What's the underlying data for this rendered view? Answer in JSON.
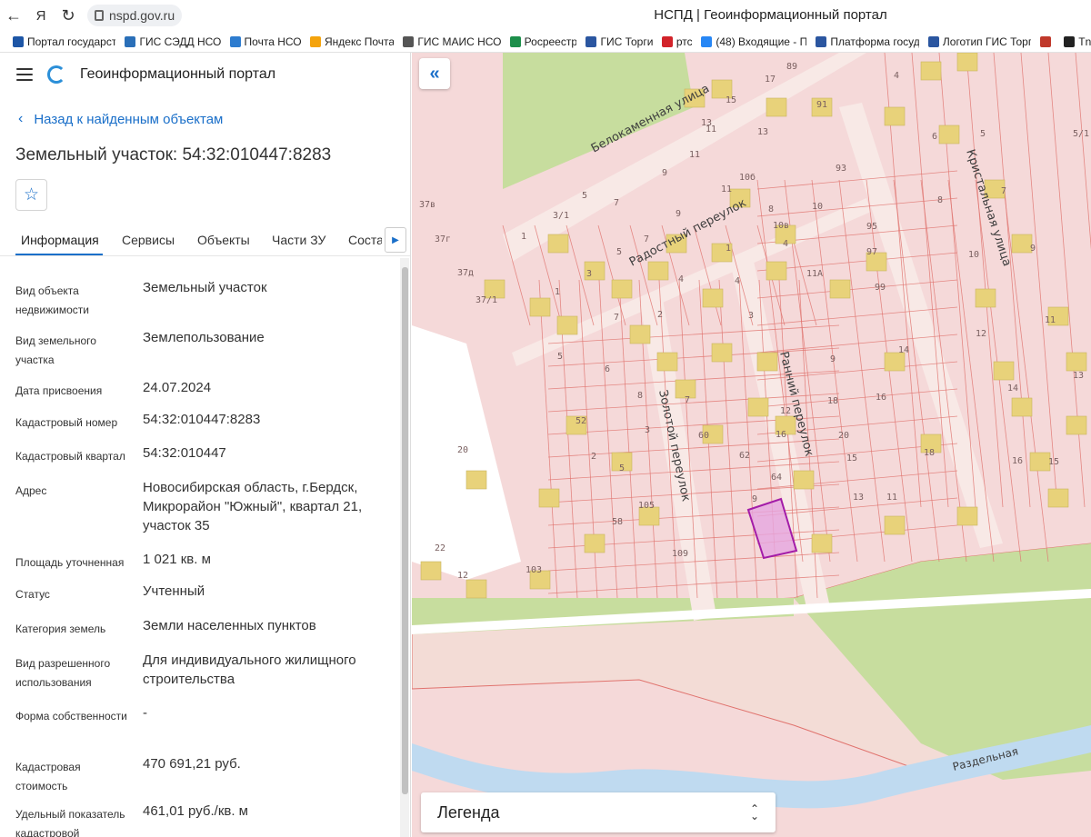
{
  "browser": {
    "url": "nspd.gov.ru",
    "title": "НСПД | Геоинформационный портал",
    "bookmarks": [
      {
        "label": "Портал государст",
        "color": "#1d56a6"
      },
      {
        "label": "ГИС СЭДД НСО",
        "color": "#2a6fb8"
      },
      {
        "label": "Почта НСО",
        "color": "#2d7ccf"
      },
      {
        "label": "Яндекс Почта",
        "color": "#f4a30c"
      },
      {
        "label": "ГИС МАИС НСО",
        "color": "#555555"
      },
      {
        "label": "Росреестр",
        "color": "#1d8f4b"
      },
      {
        "label": "ГИС Торги",
        "color": "#2b56a0"
      },
      {
        "label": "ртс",
        "color": "#d2232a"
      },
      {
        "label": "(48) Входящие - П",
        "color": "#2787f5"
      },
      {
        "label": "Платформа госуд",
        "color": "#2b56a0"
      },
      {
        "label": "Логотип ГИС Торг",
        "color": "#2b56a0"
      },
      {
        "label": "",
        "color": "#c0392b"
      },
      {
        "label": "Tn",
        "color": "#222222"
      }
    ]
  },
  "app": {
    "title": "Геоинформационный портал",
    "back_label": "Назад к найденным объектам",
    "object_title": "Земельный участок: 54:32:010447:8283",
    "tabs": [
      "Информация",
      "Сервисы",
      "Объекты",
      "Части ЗУ",
      "Состав"
    ],
    "info": [
      {
        "label": "Вид объекта недвижимости",
        "value": "Земельный участок"
      },
      {
        "label": "Вид земельного участка",
        "value": "Землепользование"
      },
      {
        "label": "Дата присвоения",
        "value": "24.07.2024"
      },
      {
        "label": "Кадастровый номер",
        "value": "54:32:010447:8283"
      },
      {
        "label": "Кадастровый квартал",
        "value": "54:32:010447"
      },
      {
        "label": "Адрес",
        "value": "Новосибирская область, г.Бердск, Микрорайон \"Южный\", квартал 21, участок 35"
      },
      {
        "label": "Площадь уточненная",
        "value": "1 021 кв. м"
      },
      {
        "label": "Статус",
        "value": "Учтенный"
      },
      {
        "label": "Категория земель",
        "value": "Земли населенных пунктов"
      },
      {
        "label": "Вид разрешенного использования",
        "value": "Для индивидуального жилищного строительства"
      },
      {
        "label": "Форма собственности",
        "value": "-"
      },
      {
        "label": "Кадастровая стоимость",
        "value": "470 691,21 руб."
      },
      {
        "label": "Удельный показатель кадастровой",
        "value": "461,01 руб./кв. м"
      }
    ]
  },
  "map": {
    "legend_label": "Легенда",
    "streets": [
      "Белокаменная улица",
      "Радостный переулок",
      "Кристальная улица",
      "Золотой переулок",
      "Ранний переулок",
      "Раздельная"
    ],
    "parcel_numbers": [
      "89",
      "17",
      "15",
      "91",
      "13",
      "13",
      "11",
      "9",
      "11",
      "4",
      "6",
      "5",
      "5/1",
      "8",
      "7",
      "9",
      "10",
      "11",
      "12",
      "13",
      "14",
      "15",
      "16",
      "37в",
      "37г",
      "37д",
      "37/1",
      "5",
      "7",
      "3/1",
      "1",
      "9",
      "5",
      "7",
      "3",
      "1",
      "1",
      "4",
      "8",
      "10",
      "93",
      "95",
      "97",
      "99",
      "4",
      "2",
      "4",
      "3",
      "5",
      "6",
      "7",
      "8",
      "52",
      "3",
      "2",
      "5",
      "58",
      "7",
      "60",
      "62",
      "9",
      "64",
      "12",
      "16",
      "18",
      "20",
      "15",
      "13",
      "11",
      "9",
      "14",
      "16",
      "18",
      "20",
      "22",
      "12",
      "103",
      "105",
      "109",
      "11",
      "10б",
      "10в",
      "11А"
    ],
    "colors": {
      "parcel_fill": "#f5d9d9",
      "parcel_line": "#e0736e",
      "building": "#e8d27a",
      "selected": "#a31ca8",
      "green": "#c7dd9e",
      "water": "#bfdaf0"
    }
  }
}
